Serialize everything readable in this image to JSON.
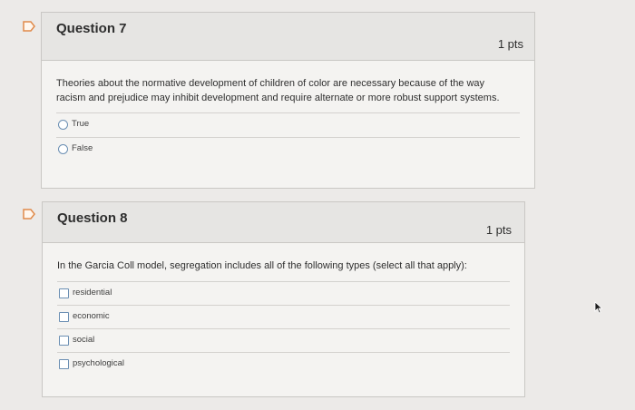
{
  "questions": [
    {
      "title": "Question 7",
      "points": "1 pts",
      "text_line1": "Theories about the normative development of children of color are necessary because of the way",
      "text_line2": "racism and prejudice may inhibit development and require alternate or more robust support systems.",
      "answer_type": "radio",
      "answers": [
        "True",
        "False"
      ]
    },
    {
      "title": "Question 8",
      "points": "1 pts",
      "text_line1": "In the Garcia Coll model, segregation includes all of the following types (select all that apply):",
      "answer_type": "checkbox",
      "answers": [
        "residential",
        "economic",
        "social",
        "psychological"
      ]
    }
  ],
  "colors": {
    "flag_border": "#e08a4a",
    "control_border": "#6b8fb3",
    "panel_bg": "#f4f3f1",
    "header_bg": "#e6e5e3"
  },
  "icons": [
    "flag-icon",
    "cursor-arrow-icon"
  ]
}
